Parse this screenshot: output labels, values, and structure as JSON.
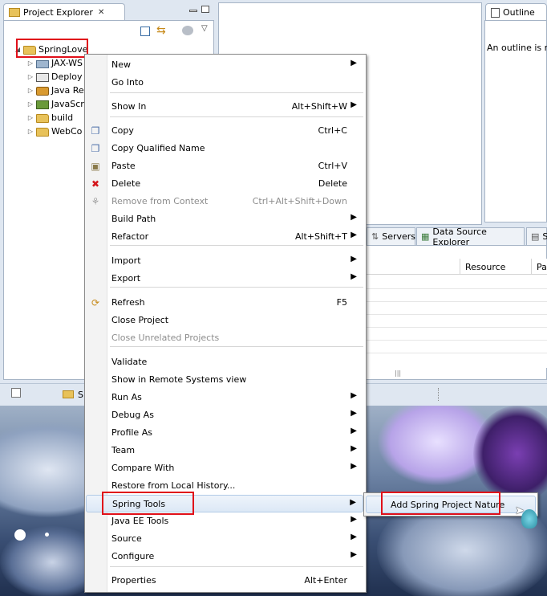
{
  "project_explorer": {
    "tab_title": "Project Explorer",
    "tree": [
      {
        "label": "SpringLove",
        "expanded": true
      },
      {
        "label": "JAX-WS"
      },
      {
        "label": "Deploy"
      },
      {
        "label": "Java Re"
      },
      {
        "label": "JavaScr"
      },
      {
        "label": "build"
      },
      {
        "label": "WebCo"
      }
    ],
    "bottom_label": "S"
  },
  "outline": {
    "tab_title": "Outline",
    "message": "An outline is n"
  },
  "bottom_panel": {
    "tabs": [
      "Servers",
      "Data Source Explorer",
      "S"
    ],
    "columns": [
      "Resource",
      "Pa"
    ]
  },
  "context_menu": {
    "items": [
      {
        "label": "New",
        "shortcut": "",
        "submenu": true,
        "icon": ""
      },
      {
        "label": "Go Into",
        "shortcut": "",
        "submenu": false,
        "icon": ""
      },
      {
        "label": "Show In",
        "shortcut": "Alt+Shift+W",
        "submenu": true,
        "icon": ""
      },
      {
        "label": "Copy",
        "shortcut": "Ctrl+C",
        "submenu": false,
        "icon": "copy-icon"
      },
      {
        "label": "Copy Qualified Name",
        "shortcut": "",
        "submenu": false,
        "icon": "copy-qualified-icon"
      },
      {
        "label": "Paste",
        "shortcut": "Ctrl+V",
        "submenu": false,
        "icon": "paste-icon"
      },
      {
        "label": "Delete",
        "shortcut": "Delete",
        "submenu": false,
        "icon": "delete-icon"
      },
      {
        "label": "Remove from Context",
        "shortcut": "Ctrl+Alt+Shift+Down",
        "submenu": false,
        "icon": "remove-context-icon",
        "disabled": true
      },
      {
        "label": "Build Path",
        "shortcut": "",
        "submenu": true,
        "icon": ""
      },
      {
        "label": "Refactor",
        "shortcut": "Alt+Shift+T",
        "submenu": true,
        "icon": ""
      },
      {
        "label": "Import",
        "shortcut": "",
        "submenu": true,
        "icon": ""
      },
      {
        "label": "Export",
        "shortcut": "",
        "submenu": true,
        "icon": ""
      },
      {
        "label": "Refresh",
        "shortcut": "F5",
        "submenu": false,
        "icon": "refresh-icon"
      },
      {
        "label": "Close Project",
        "shortcut": "",
        "submenu": false,
        "icon": ""
      },
      {
        "label": "Close Unrelated Projects",
        "shortcut": "",
        "submenu": false,
        "icon": "",
        "disabled": true
      },
      {
        "label": "Validate",
        "shortcut": "",
        "submenu": false,
        "icon": ""
      },
      {
        "label": "Show in Remote Systems view",
        "shortcut": "",
        "submenu": false,
        "icon": ""
      },
      {
        "label": "Run As",
        "shortcut": "",
        "submenu": true,
        "icon": ""
      },
      {
        "label": "Debug As",
        "shortcut": "",
        "submenu": true,
        "icon": ""
      },
      {
        "label": "Profile As",
        "shortcut": "",
        "submenu": true,
        "icon": ""
      },
      {
        "label": "Team",
        "shortcut": "",
        "submenu": true,
        "icon": ""
      },
      {
        "label": "Compare With",
        "shortcut": "",
        "submenu": true,
        "icon": ""
      },
      {
        "label": "Restore from Local History...",
        "shortcut": "",
        "submenu": false,
        "icon": ""
      },
      {
        "label": "Spring Tools",
        "shortcut": "",
        "submenu": true,
        "icon": "",
        "highlighted": true
      },
      {
        "label": "Java EE Tools",
        "shortcut": "",
        "submenu": true,
        "icon": ""
      },
      {
        "label": "Source",
        "shortcut": "",
        "submenu": true,
        "icon": ""
      },
      {
        "label": "Configure",
        "shortcut": "",
        "submenu": true,
        "icon": ""
      },
      {
        "label": "Properties",
        "shortcut": "Alt+Enter",
        "submenu": false,
        "icon": ""
      }
    ]
  },
  "spring_submenu": {
    "items": [
      {
        "label": "Add Spring Project Nature"
      }
    ]
  },
  "colors": {
    "highlight_box": "#e0101a",
    "menu_hover": "#dce8f6"
  }
}
